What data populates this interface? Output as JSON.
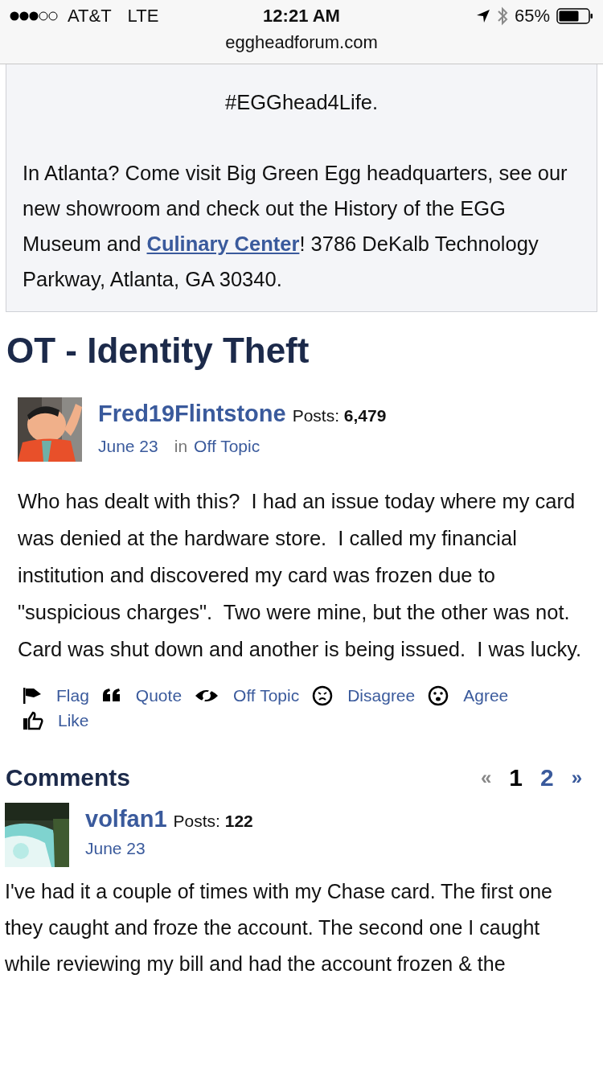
{
  "status_bar": {
    "carrier": "AT&T",
    "network": "LTE",
    "time": "12:21 AM",
    "battery": "65%"
  },
  "address_bar": {
    "url": "eggheadforum.com"
  },
  "announcement": {
    "lines": [
      "#EGGhead4Life."
    ],
    "paragraph": "In Atlanta? Come visit Big Green Egg headquarters, see our new showroom and check out the History of the EGG Museum and ",
    "link": "Culinary Center",
    "paragraph_end": "!  3786 DeKalb Technology Parkway, Atlanta, GA 30340."
  },
  "post": {
    "title": "OT - Identity Theft",
    "author": "Fred19Flintstone",
    "posts_label": "Posts:",
    "posts_count": "6,479",
    "date": "June 23",
    "category_prefix": "in",
    "category": "Off Topic",
    "body": "Who has dealt with this?  I had an issue today where my card was denied at the hardware store.  I called my financial institution and discovered my card was frozen due to \"suspicious charges\".  Two were mine, but the other was not.  Card was shut down and another is being issued.  I was lucky.",
    "actions": [
      {
        "kind": "flag",
        "label": "Flag"
      },
      {
        "kind": "quote",
        "label": "Quote"
      },
      {
        "kind": "offtopic",
        "label": "Off Topic"
      },
      {
        "kind": "disagree",
        "label": "Disagree"
      },
      {
        "kind": "agree",
        "label": "Agree"
      },
      {
        "kind": "like",
        "label": "Like"
      }
    ]
  },
  "comments": {
    "heading": "Comments",
    "pagination": {
      "prev": "«",
      "pages": [
        {
          "label": "1",
          "selected": true
        },
        {
          "label": "2",
          "selected": false
        }
      ],
      "next": "»"
    },
    "items": [
      {
        "author": "volfan1",
        "posts_label": "Posts:",
        "posts_count": "122",
        "date": "June 23",
        "body": "I've had it a couple of times with my Chase card. The first one they caught and froze the account. The second one I caught while reviewing my bill and had the account frozen & the"
      }
    ]
  }
}
